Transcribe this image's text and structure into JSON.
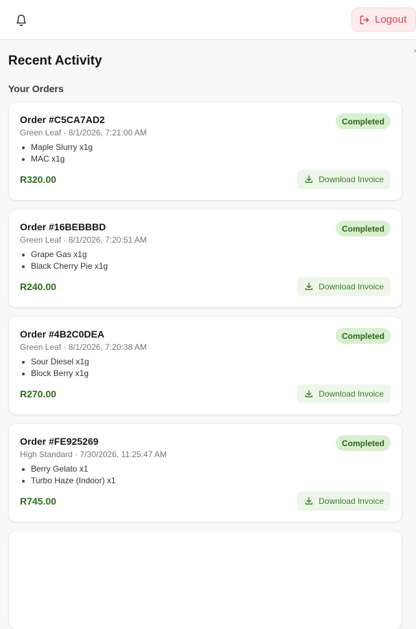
{
  "header": {
    "bell_icon": "bell-icon",
    "logout_icon": "logout-icon",
    "logout_label": "Logout",
    "logout_color": "#d2434d"
  },
  "page": {
    "title": "Recent Activity",
    "section_title": "Your Orders"
  },
  "colors": {
    "badge_bg": "#d8f0cf",
    "price": "#2f6b1d",
    "invoice_bg": "#eef6ea"
  },
  "orders": [
    {
      "title": "Order #C5CA7AD2",
      "meta": "Green Leaf · 8/1/2026, 7:21:00 AM",
      "items": [
        "Maple Slurry x1g",
        "MAC x1g"
      ],
      "total": "R320.00",
      "status": "Completed",
      "invoice_label": "Download Invoice"
    },
    {
      "title": "Order #16BEBBBD",
      "meta": "Green Leaf · 8/1/2026, 7:20:51 AM",
      "items": [
        "Grape Gas x1g",
        "Black Cherry Pie x1g"
      ],
      "total": "R240.00",
      "status": "Completed",
      "invoice_label": "Download Invoice"
    },
    {
      "title": "Order #4B2C0DEA",
      "meta": "Green Leaf · 8/1/2026, 7:20:38 AM",
      "items": [
        "Sour Diesel x1g",
        "Block Berry x1g"
      ],
      "total": "R270.00",
      "status": "Completed",
      "invoice_label": "Download Invoice"
    },
    {
      "title": "Order #FE925269",
      "meta": "High Standard · 7/30/2026, 11:25:47 AM",
      "items": [
        "Berry Gelato x1",
        "Turbo Haze (Indoor) x1"
      ],
      "total": "R745.00",
      "status": "Completed",
      "invoice_label": "Download Invoice"
    }
  ]
}
